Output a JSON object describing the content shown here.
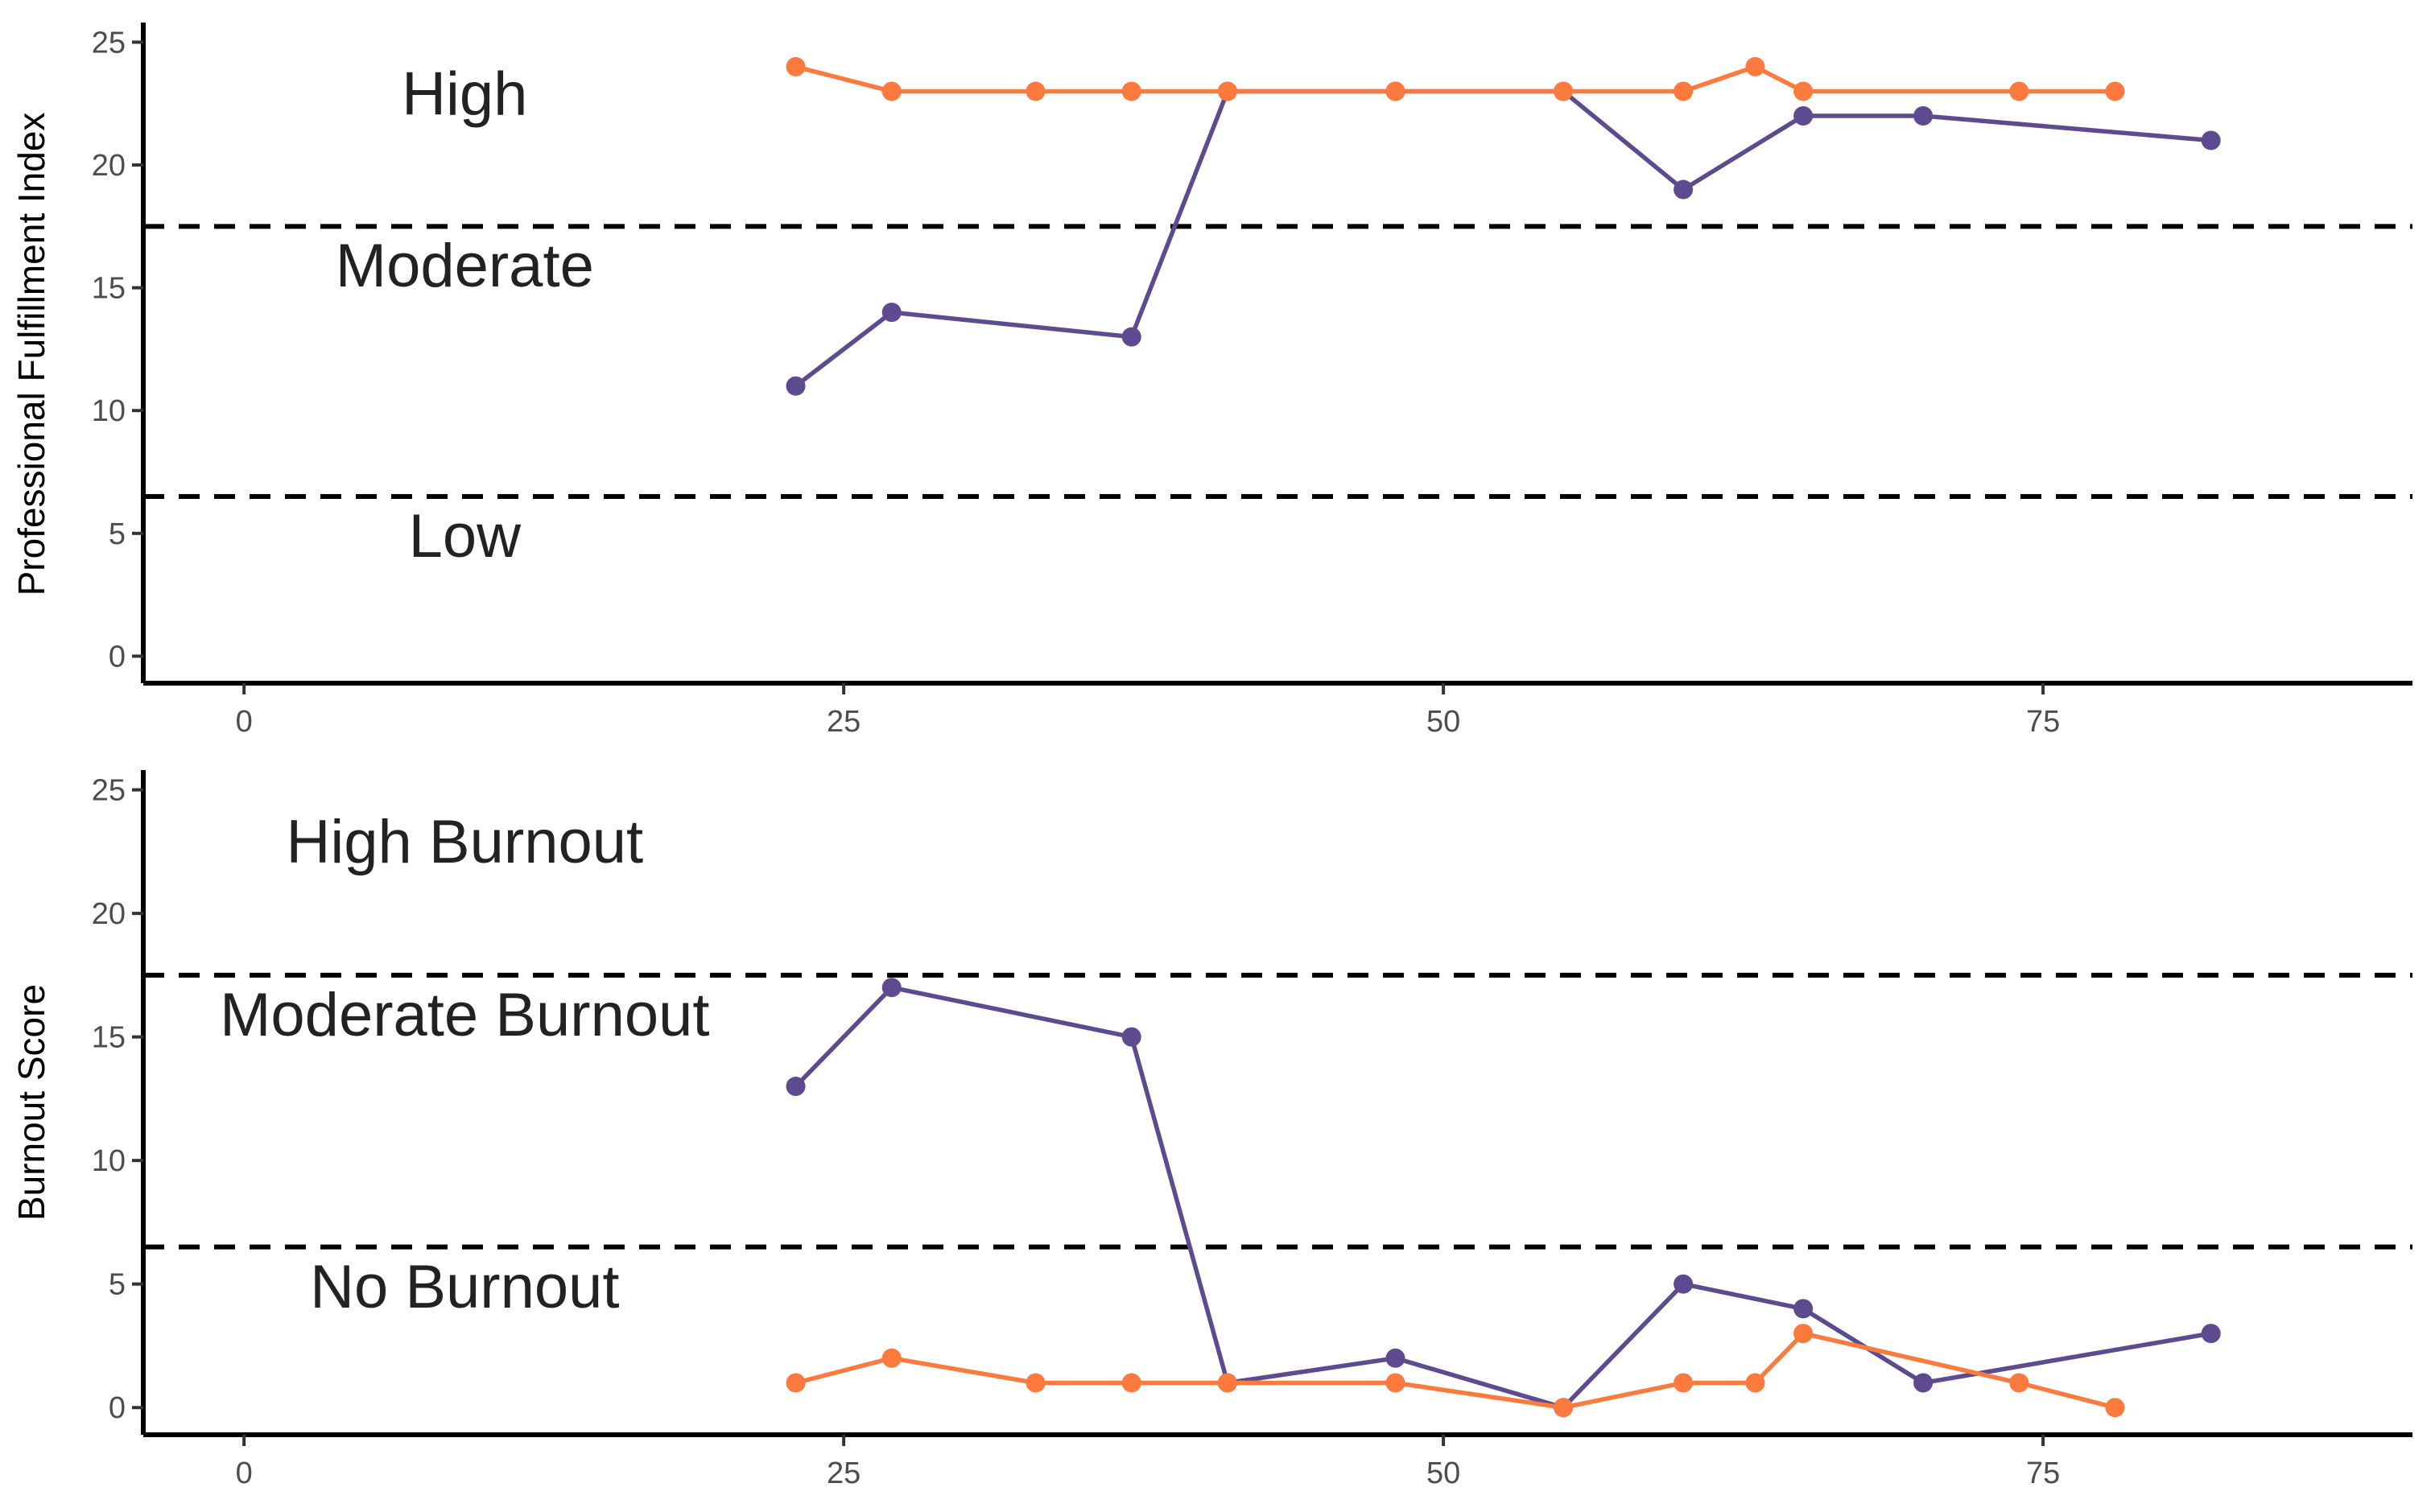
{
  "chart_data": [
    {
      "type": "line",
      "title": "",
      "xlabel": "",
      "ylabel": "Professional Fulfillment Index",
      "xlim": [
        -4.2,
        90.4
      ],
      "ylim": [
        -1.1,
        25.8
      ],
      "x_ticks": [
        0,
        25,
        50,
        75
      ],
      "y_ticks": [
        0,
        5,
        10,
        15,
        20,
        25
      ],
      "x_tick_labels": [
        "0",
        "25",
        "50",
        "75"
      ],
      "y_tick_labels": [
        "0",
        "5",
        "10",
        "15",
        "20",
        "25"
      ],
      "grid": false,
      "legend": null,
      "thresholds": [
        17.5,
        6.5
      ],
      "annotations": [
        {
          "text": "High",
          "x": 9.2,
          "y": 22.9
        },
        {
          "text": "Moderate",
          "x": 9.2,
          "y": 15.9
        },
        {
          "text": "Low",
          "x": 9.2,
          "y": 4.9
        }
      ],
      "series": [
        {
          "name": "purple-series",
          "color": "#5e4b8f",
          "x": [
            23,
            27,
            37,
            41,
            48,
            55,
            60,
            65,
            70,
            82
          ],
          "y": [
            11,
            14,
            13,
            23,
            23,
            23,
            19,
            22,
            22,
            21
          ]
        },
        {
          "name": "orange-series",
          "color": "#fd7a3e",
          "x": [
            23,
            27,
            33,
            37,
            41,
            48,
            55,
            60,
            63,
            65,
            74,
            78
          ],
          "y": [
            24,
            23,
            23,
            23,
            23,
            23,
            23,
            23,
            24,
            23,
            23,
            23
          ]
        }
      ]
    },
    {
      "type": "line",
      "title": "",
      "xlabel": "",
      "ylabel": "Burnout Score",
      "xlim": [
        -4.2,
        90.4
      ],
      "ylim": [
        -1.1,
        25.8
      ],
      "x_ticks": [
        0,
        25,
        50,
        75
      ],
      "y_ticks": [
        0,
        5,
        10,
        15,
        20,
        25
      ],
      "x_tick_labels": [
        "0",
        "25",
        "50",
        "75"
      ],
      "y_tick_labels": [
        "0",
        "5",
        "10",
        "15",
        "20",
        "25"
      ],
      "grid": false,
      "legend": null,
      "thresholds": [
        17.5,
        6.5
      ],
      "annotations": [
        {
          "text": "High Burnout",
          "x": 9.2,
          "y": 22.9
        },
        {
          "text": "Moderate Burnout",
          "x": 9.2,
          "y": 15.9
        },
        {
          "text": "No Burnout",
          "x": 9.2,
          "y": 4.9
        }
      ],
      "series": [
        {
          "name": "purple-series",
          "color": "#5e4b8f",
          "x": [
            23,
            27,
            37,
            41,
            48,
            55,
            60,
            65,
            70,
            82
          ],
          "y": [
            13,
            17,
            15,
            1,
            2,
            0,
            5,
            4,
            1,
            3
          ]
        },
        {
          "name": "orange-series",
          "color": "#fd7a3e",
          "x": [
            23,
            27,
            33,
            37,
            41,
            48,
            55,
            60,
            63,
            65,
            74,
            78
          ],
          "y": [
            1,
            2,
            1,
            1,
            1,
            1,
            0,
            1,
            1,
            3,
            1,
            0
          ]
        }
      ]
    }
  ]
}
